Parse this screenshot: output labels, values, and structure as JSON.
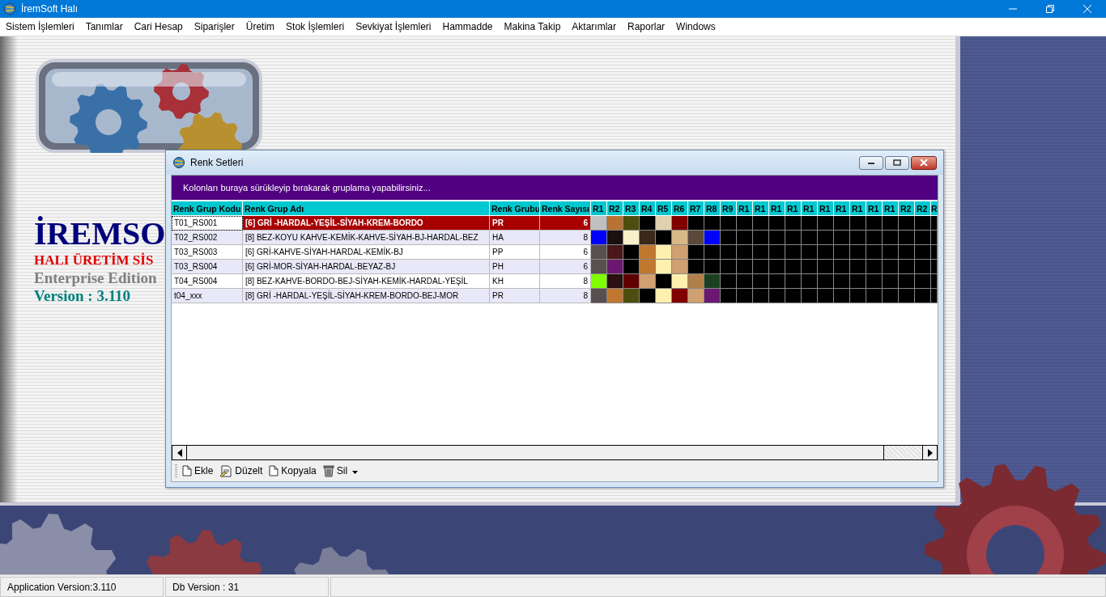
{
  "app": {
    "title": "İremSoft Halı"
  },
  "menu": [
    "Sistem İşlemleri",
    "Tanımlar",
    "Cari Hesap",
    "Siparişler",
    "Üretim",
    "Stok İşlemleri",
    "Sevkiyat İşlemleri",
    "Hammadde",
    "Makina Takip",
    "Aktarımlar",
    "Raporlar",
    "Windows"
  ],
  "branding": {
    "name": "İREMSO",
    "subtitle": "HALI ÜRETİM SİS",
    "edition": "Enterprise Edition",
    "version": "Version : 3.110"
  },
  "child_window": {
    "title": "Renk Setleri",
    "group_hint": "Kolonları buraya sürükleyip bırakarak gruplama yapabilirsiniz...",
    "columns": [
      "Renk Grup Kodu",
      "Renk Grup Adı",
      "Renk Grubu",
      "Renk Sayısı",
      "R1",
      "R2",
      "R3",
      "R4",
      "R5",
      "R6",
      "R7",
      "R8",
      "R9",
      "R1",
      "R1",
      "R1",
      "R1",
      "R1",
      "R1",
      "R1",
      "R1",
      "R1",
      "R1",
      "R2",
      "R2",
      "R"
    ],
    "rows": [
      {
        "code": "T01_RS001",
        "name": "[6] GRİ -HARDAL-YEŞİL-SİYAH-KREM-BORDO",
        "group": "PR",
        "count": "6",
        "selected": true,
        "swatches": [
          {
            "color": "#c0c0c0"
          },
          {
            "color": "#b87333"
          },
          {
            "color": "#4d4d10"
          },
          {
            "color": "#000000"
          },
          {
            "color": "#e0d0b0"
          },
          {
            "color": "#800000"
          }
        ]
      },
      {
        "code": "T02_RS002",
        "name": "[8] BEZ-KOYU KAHVE-KEMİK-KAHVE-SİYAH-BJ-HARDAL-BEZ",
        "group": "HA",
        "count": "8",
        "selected": false,
        "swatches": [
          {
            "color": "#0000ff"
          },
          {
            "color": "#1a1010"
          },
          {
            "color": "#f8f0c8"
          },
          {
            "color": "#3a2818"
          },
          {
            "color": "#000000"
          },
          {
            "color": "#d8b888"
          },
          {
            "color": "#5a4838"
          },
          {
            "color": "#0000ff"
          }
        ]
      },
      {
        "code": "T03_RS003",
        "name": "[6] GRİ-KAHVE-SİYAH-HARDAL-KEMİK-BJ",
        "group": "PP",
        "count": "6",
        "selected": false,
        "swatches": [
          {
            "color": "#585050"
          },
          {
            "color": "#4a1818"
          },
          {
            "color": "#000000"
          },
          {
            "color": "#c07830"
          },
          {
            "color": "#fff0b0"
          },
          {
            "color": "#d0a070"
          }
        ]
      },
      {
        "code": "T03_RS004",
        "name": "[6] GRİ-MOR-SİYAH-HARDAL-BEYAZ-BJ",
        "group": "PH",
        "count": "6",
        "selected": false,
        "swatches": [
          {
            "color": "#585050"
          },
          {
            "color": "#6a1870"
          },
          {
            "color": "#000000"
          },
          {
            "color": "#c07830"
          },
          {
            "color": "#fff0b0"
          },
          {
            "color": "#d0a070"
          }
        ]
      },
      {
        "code": "T04_RS004",
        "name": "[8] BEZ-KAHVE-BORDO-BEJ-SİYAH-KEMİK-HARDAL-YEŞİL",
        "group": "KH",
        "count": "8",
        "selected": false,
        "swatches": [
          {
            "color": "#80ff00"
          },
          {
            "color": "#2a1010"
          },
          {
            "color": "#600000"
          },
          {
            "color": "#d0a070"
          },
          {
            "color": "#000000"
          },
          {
            "color": "#fff0b0"
          },
          {
            "color": "#b08048"
          },
          {
            "color": "#1a4020"
          }
        ]
      },
      {
        "code": "t04_xxx",
        "name": "[8] GRİ -HARDAL-YEŞİL-SİYAH-KREM-BORDO-BEJ-MOR",
        "group": "PR",
        "count": "8",
        "selected": false,
        "swatches": [
          {
            "color": "#585050"
          },
          {
            "color": "#c07830"
          },
          {
            "color": "#4d4d10"
          },
          {
            "color": "#000000"
          },
          {
            "color": "#fff0b0"
          },
          {
            "color": "#800000"
          },
          {
            "color": "#d0a070"
          },
          {
            "color": "#6a1870"
          }
        ]
      }
    ],
    "toolbar": [
      {
        "label": "Ekle",
        "kind": "new"
      },
      {
        "label": "Düzelt",
        "kind": "edit"
      },
      {
        "label": "Kopyala",
        "kind": "copy"
      },
      {
        "label": "Sil",
        "kind": "delete"
      }
    ]
  },
  "status_bar": [
    "Application Version:3.110",
    "Db Version : 31"
  ]
}
